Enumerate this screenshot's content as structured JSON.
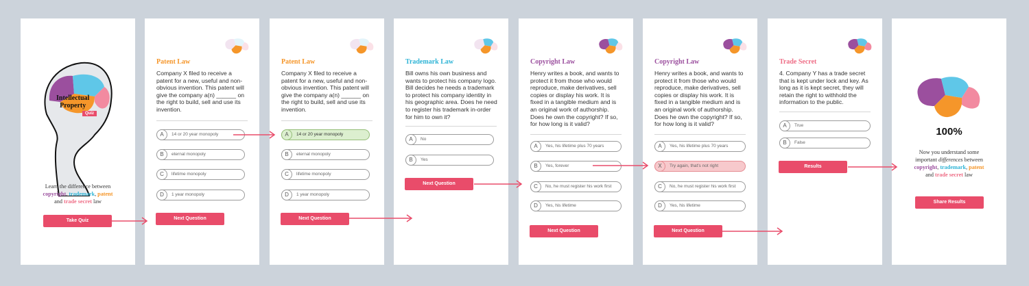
{
  "colors": {
    "accent": "#e94c6a",
    "purple": "#9b4f9e",
    "cyan": "#2fb4d6",
    "orange": "#f5962a",
    "pink": "#ee6d86",
    "green_fill": "#dcefcf",
    "red_fill": "#f7c9cc"
  },
  "screen1": {
    "logo_line1": "Intellectual",
    "logo_line2": "Property",
    "logo_badge": "Quiz",
    "intro_line1": "Learn the difference between",
    "kw_copyright": "copyright",
    "kw_trademark": "trademark",
    "kw_patent": "patent",
    "and": "and",
    "kw_trade_secret": "trade secret",
    "law": "law",
    "button": "Take Quiz"
  },
  "screen2": {
    "title": "Patent Law",
    "question": "Company X filed to receive a patent for a new, useful and non-obvious invention. This patent will give the company a(n) ______ on the right to build, sell and use its invention.",
    "options": [
      {
        "letter": "A",
        "text": "14 or 20 year monopoly"
      },
      {
        "letter": "B",
        "text": "eternal monopoly"
      },
      {
        "letter": "C",
        "text": "lifetime monopoly"
      },
      {
        "letter": "D",
        "text": "1 year monopoly"
      }
    ],
    "button": "Next Question"
  },
  "screen3": {
    "title": "Patent Law",
    "question": "Company X filed to receive a patent for a new, useful and non-obvious invention. This patent will give the company a(n) ______ on the right to build, sell and use its invention.",
    "options": [
      {
        "letter": "A",
        "text": "14 or 20 year monopoly"
      },
      {
        "letter": "B",
        "text": "eternal monopoly"
      },
      {
        "letter": "C",
        "text": "lifetime monopoly"
      },
      {
        "letter": "D",
        "text": "1 year monopoly"
      }
    ],
    "button": "Next Question"
  },
  "screen4": {
    "title": "Trademark Law",
    "question": "Bill owns his own business and wants to protect his company logo. Bill decides he needs a trademark to protect his company identity in his geographic area. Does he need to register his trademark in-order for him to own it?",
    "options": [
      {
        "letter": "A",
        "text": "No"
      },
      {
        "letter": "B",
        "text": "Yes"
      }
    ],
    "button": "Next Question"
  },
  "screen5": {
    "title": "Copyright Law",
    "question": "Henry writes a book, and wants to protect it from those who would reproduce, make derivatives, sell copies or display his work. It is fixed in a tangible medium and is an original work of authorship. Does he own the copyright? If so, for how long is it valid?",
    "options": [
      {
        "letter": "A",
        "text": "Yes, his lifetime plus 70 years"
      },
      {
        "letter": "B",
        "text": "Yes, forever"
      },
      {
        "letter": "C",
        "text": "No, he must register his work first"
      },
      {
        "letter": "D",
        "text": "Yes, his lifetime"
      }
    ],
    "button": "Next Question"
  },
  "screen6": {
    "title": "Copyright Law",
    "question": "Henry writes a book, and wants to protect it from those who would reproduce, make derivatives, sell copies or display his work. It is fixed in a tangible medium and is an original work of authorship. Does he own the copyright? If so, for how long is it valid?",
    "options": [
      {
        "letter": "A",
        "text": "Yes, his lifetime plus 70 years"
      },
      {
        "letter": "X",
        "text": "Try again, that's not right"
      },
      {
        "letter": "C",
        "text": "No, he must register his work first"
      },
      {
        "letter": "D",
        "text": "Yes, his lifetime"
      }
    ],
    "button": "Next Question"
  },
  "screen7": {
    "title": "Trade Secret",
    "question": "4. Company Y has a trade secret that is kept under lock and key. As long as it is kept secret, they will retain the right to withhold the information to the public.",
    "options": [
      {
        "letter": "A",
        "text": "True"
      },
      {
        "letter": "B",
        "text": "False"
      }
    ],
    "button": "Results"
  },
  "screen8": {
    "score": "100%",
    "text_line1": "Now you understand some",
    "text_line2a": "important",
    "text_line2b": "differences",
    "text_line2c": "between",
    "kw_copyright": "copyright",
    "kw_trademark": "trademark",
    "kw_patent": "patent",
    "and": "and",
    "kw_trade_secret": "trade secret",
    "law": "law",
    "button": "Share Results"
  }
}
